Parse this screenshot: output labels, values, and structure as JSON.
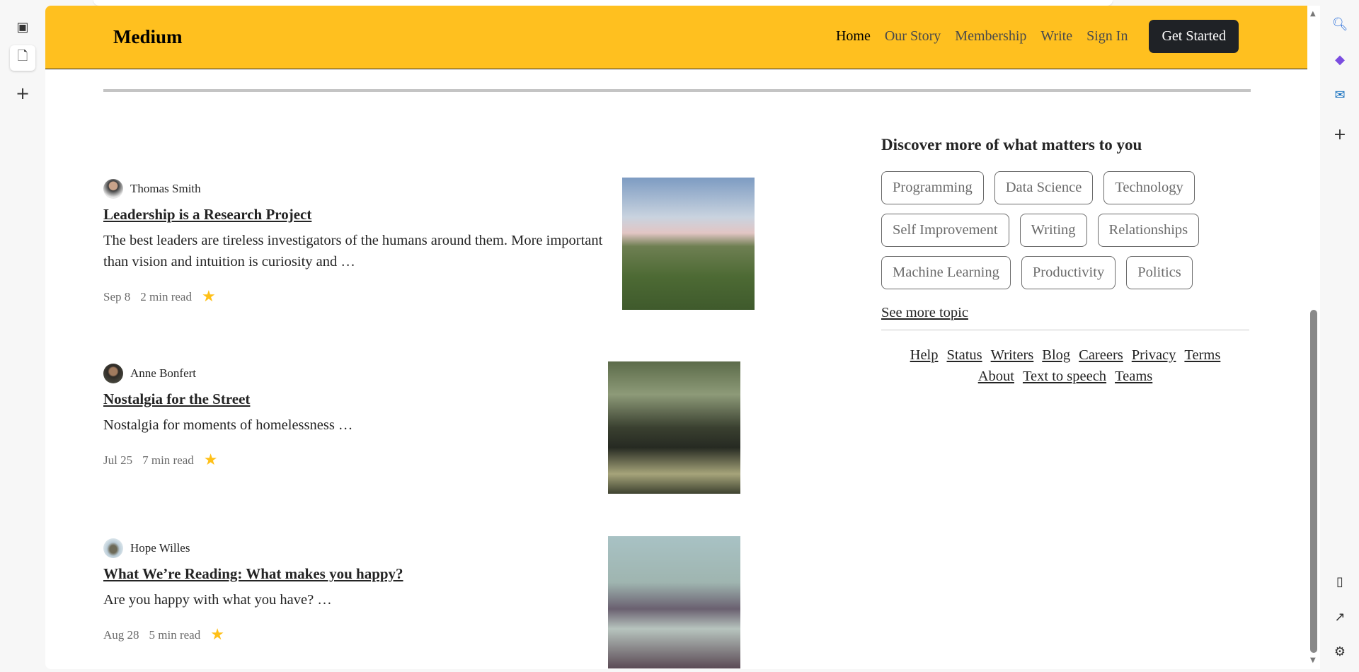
{
  "header": {
    "logo": "Medium",
    "nav": [
      "Home",
      "Our Story",
      "Membership",
      "Write",
      "Sign In"
    ],
    "cta": "Get Started"
  },
  "articles": [
    {
      "author": "Thomas Smith",
      "title": "Leadership is a Research Project",
      "description": "The best leaders are tireless investigators of the humans around them. More important than vision and intuition is curiosity and …",
      "date": "Sep 8",
      "read_time": "2 min read"
    },
    {
      "author": "Anne Bonfert",
      "title": "Nostalgia for the Street",
      "description": "Nostalgia for moments of homelessness …",
      "date": "Jul 25",
      "read_time": "7 min read"
    },
    {
      "author": "Hope Willes",
      "title": "What We’re Reading: What makes you happy?",
      "description": "Are you happy with what you have? …",
      "date": "Aug 28",
      "read_time": "5 min read"
    }
  ],
  "sidebar": {
    "heading": "Discover more of what matters to you",
    "topics": [
      "Programming",
      "Data Science",
      "Technology",
      "Self Improvement",
      "Writing",
      "Relationships",
      "Machine Learning",
      "Productivity",
      "Politics"
    ],
    "see_more": "See more topic",
    "footer_links": [
      "Help",
      "Status",
      "Writers",
      "Blog",
      "Careers",
      "Privacy",
      "Terms",
      "About",
      "Text to speech",
      "Teams"
    ]
  },
  "colors": {
    "brand": "#ffc01f",
    "button": "#1f2226",
    "star": "#ffc017"
  }
}
